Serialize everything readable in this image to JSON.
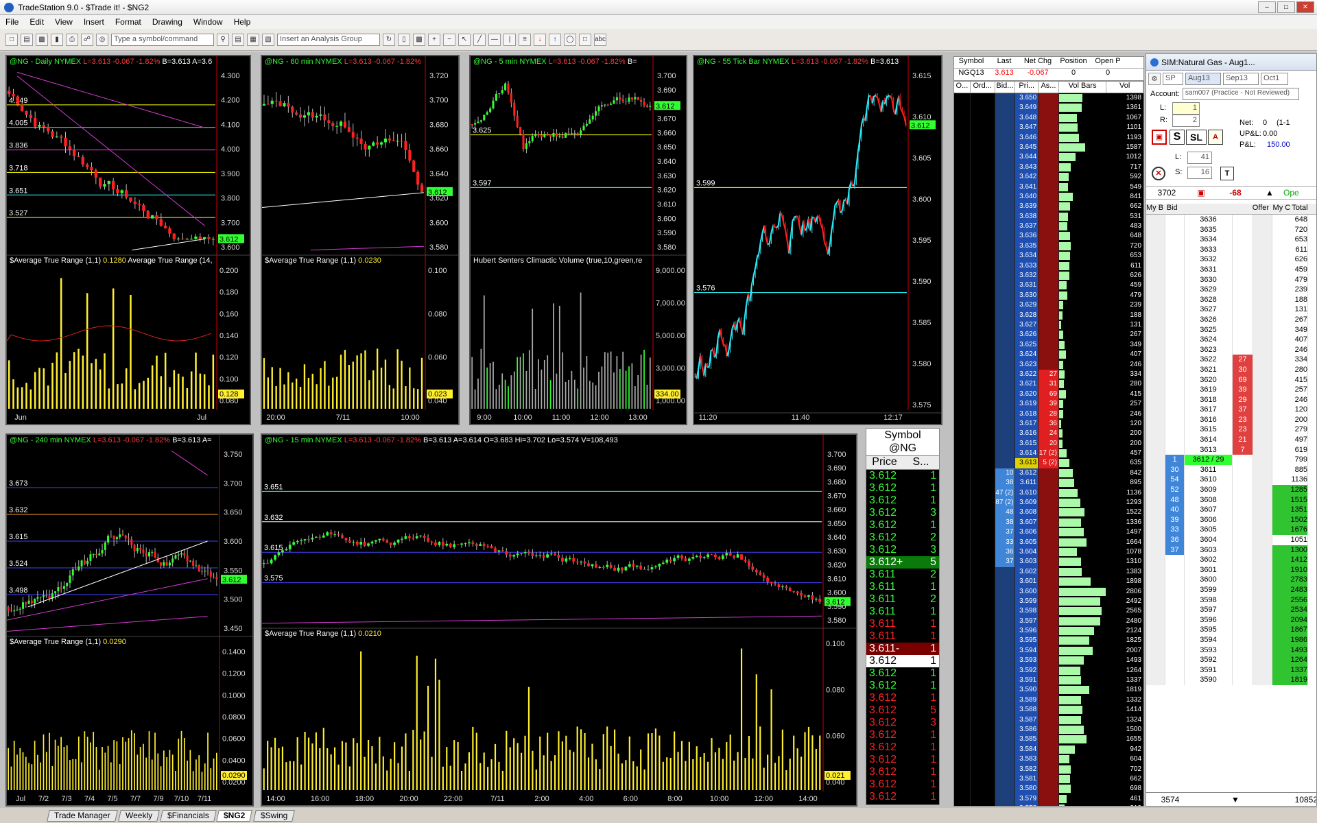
{
  "app": {
    "title": "TradeStation 9.0 - $Trade it! - $NG2",
    "menu": [
      "File",
      "Edit",
      "View",
      "Insert",
      "Format",
      "Drawing",
      "Window",
      "Help"
    ],
    "symbol_placeholder": "Type a symbol/command",
    "analysis_group": "Insert an Analysis Group"
  },
  "charts": [
    {
      "id": "daily",
      "title": "@NG - Daily  NYMEX",
      "quote": "L=3.613  -0.067  -1.82%",
      "extra": "B=3.613  A=3.6",
      "sub": "$Average True Range (1,1)",
      "subval": "0.1280",
      "sub2": "Average True Range (14,",
      "yticks": [
        "4.300",
        "4.200",
        "4.100",
        "4.000",
        "3.900",
        "3.800",
        "3.700",
        "3.600"
      ],
      "subticks": [
        "0.200",
        "0.180",
        "0.160",
        "0.140",
        "0.120",
        "0.100",
        "0.080"
      ],
      "xticks": [
        "Jun",
        "Jul"
      ],
      "levels": [
        "4.149",
        "4.005",
        "3.836",
        "3.718",
        "3.651",
        "3.527"
      ],
      "last": "3.612",
      "sublast": "0.128"
    },
    {
      "id": "m60",
      "title": "@NG - 60 min  NYMEX",
      "quote": "L=3.613  -0.067  -1.82%",
      "extra": "",
      "sub": "$Average True Range (1,1)",
      "subval": "0.0230",
      "yticks": [
        "3.720",
        "3.700",
        "3.680",
        "3.660",
        "3.640",
        "3.620",
        "3.600",
        "3.580"
      ],
      "subticks": [
        "0.100",
        "0.080",
        "0.060",
        "0.040"
      ],
      "xticks": [
        "20:00",
        "7/11",
        "10:00"
      ],
      "last": "3.612",
      "sublast": "0.023"
    },
    {
      "id": "m5",
      "title": "@NG - 5 min  NYMEX",
      "quote": "L=3.613  -0.067  -1.82%",
      "extra": "B=",
      "sub": "Hubert Senters Climactic Volume (true,10,green,re",
      "yticks": [
        "3.700",
        "3.690",
        "3.680",
        "3.670",
        "3.660",
        "3.650",
        "3.640",
        "3.630",
        "3.620",
        "3.610",
        "3.600",
        "3.590",
        "3.580"
      ],
      "subticks": [
        "9,000.00",
        "7,000.00",
        "5,000.00",
        "3,000.00",
        "1,000.00"
      ],
      "xticks": [
        "9:00",
        "10:00",
        "11:00",
        "12:00",
        "13:00"
      ],
      "levels": [
        "3.625",
        "3.597"
      ],
      "last": "3.612",
      "sublast": "334.00"
    },
    {
      "id": "tick",
      "title": "@NG - 55 Tick Bar  NYMEX",
      "quote": "L=3.613  -0.067  -1.82%",
      "extra": "B=3.613",
      "yticks": [
        "3.615",
        "3.610",
        "3.605",
        "3.600",
        "3.595",
        "3.590",
        "3.585",
        "3.580",
        "3.575"
      ],
      "xticks": [
        "11:20",
        "11:40",
        "12:17"
      ],
      "levels": [
        "3.599",
        "3.576"
      ],
      "last": "3.612"
    },
    {
      "id": "m240",
      "title": "@NG - 240 min  NYMEX",
      "quote": "L=3.613  -0.067  -1.82%",
      "extra": "B=3.613  A=",
      "sub": "$Average True Range (1,1)",
      "subval": "0.0290",
      "yticks": [
        "3.750",
        "3.700",
        "3.650",
        "3.600",
        "3.550",
        "3.500",
        "3.450"
      ],
      "subticks": [
        "0.1400",
        "0.1200",
        "0.1000",
        "0.0800",
        "0.0600",
        "0.0400",
        "0.0200"
      ],
      "xticks": [
        "Jul",
        "7/2",
        "7/3",
        "7/4",
        "7/5",
        "7/7",
        "7/9",
        "7/10",
        "7/11"
      ],
      "levels": [
        "3.673",
        "3.632",
        "3.615",
        "3.524",
        "3.498"
      ],
      "last": "3.612",
      "sublast": "0.0290"
    },
    {
      "id": "m15",
      "title": "@NG - 15 min  NYMEX",
      "quote": "L=3.613  -0.067  -1.82%",
      "extra": "B=3.613  A=3.614",
      "ohlc": "O=3.683  Hi=3.702  Lo=3.574  V=108,493",
      "sub": "$Average True Range (1,1)",
      "subval": "0.0210",
      "yticks": [
        "3.700",
        "3.690",
        "3.680",
        "3.670",
        "3.660",
        "3.650",
        "3.640",
        "3.630",
        "3.620",
        "3.610",
        "3.600",
        "3.590",
        "3.580"
      ],
      "subticks": [
        "0.100",
        "0.080",
        "0.060",
        "0.040"
      ],
      "xticks": [
        "14:00",
        "16:00",
        "18:00",
        "20:00",
        "22:00",
        "7/11",
        "2:00",
        "4:00",
        "6:00",
        "8:00",
        "10:00",
        "12:00",
        "14:00"
      ],
      "levels": [
        "3.651",
        "3.632",
        "3.615",
        "3.575"
      ],
      "last": "3.612",
      "sublast": "0.021"
    }
  ],
  "tns": {
    "title": "Symbol",
    "symbol": "@NG",
    "col_price": "Price",
    "col_size": "S...",
    "rows": [
      [
        "3.612",
        "1",
        "g"
      ],
      [
        "3.612",
        "1",
        "g"
      ],
      [
        "3.612",
        "1",
        "g"
      ],
      [
        "3.612",
        "3",
        "g"
      ],
      [
        "3.612",
        "1",
        "g"
      ],
      [
        "3.612",
        "2",
        "g"
      ],
      [
        "3.612",
        "3",
        "g"
      ],
      [
        "3.612+",
        "5",
        "gb"
      ],
      [
        "3.611",
        "2",
        "g"
      ],
      [
        "3.611",
        "1",
        "g"
      ],
      [
        "3.611",
        "2",
        "g"
      ],
      [
        "3.611",
        "1",
        "g"
      ],
      [
        "3.611",
        "1",
        "r"
      ],
      [
        "3.611",
        "1",
        "r"
      ],
      [
        "3.611-",
        "1",
        "rb"
      ],
      [
        "3.612",
        "1",
        "w"
      ],
      [
        "3.612",
        "1",
        "g"
      ],
      [
        "3.612",
        "1",
        "g"
      ],
      [
        "3.612",
        "1",
        "r"
      ],
      [
        "3.612",
        "5",
        "r"
      ],
      [
        "3.612",
        "3",
        "r"
      ],
      [
        "3.612",
        "1",
        "r"
      ],
      [
        "3.612",
        "1",
        "r"
      ],
      [
        "3.612",
        "1",
        "r"
      ],
      [
        "3.612",
        "1",
        "r"
      ],
      [
        "3.612",
        "1",
        "r"
      ],
      [
        "3.612",
        "1",
        "r"
      ]
    ]
  },
  "quote": {
    "symbol_h": "Symbol",
    "last_h": "Last",
    "net_h": "Net Chg",
    "pos_h": "Position",
    "open_h": "Open P",
    "symbol": "NGQ13",
    "last": "3.613",
    "net": "-0.067",
    "pos": "0",
    "open": "0"
  },
  "ladder": {
    "cols": [
      "O...",
      "Ord...",
      "Bid...",
      "Pri...",
      "As...",
      "Vol Bars",
      "Vol"
    ],
    "rows": [
      [
        "",
        "3.650",
        "",
        "1398"
      ],
      [
        "",
        "3.649",
        "",
        "1361"
      ],
      [
        "",
        "3.648",
        "",
        "1067"
      ],
      [
        "",
        "3.647",
        "",
        "1101"
      ],
      [
        "",
        "3.646",
        "",
        "1193"
      ],
      [
        "",
        "3.645",
        "",
        "1587"
      ],
      [
        "",
        "3.644",
        "",
        "1012"
      ],
      [
        "",
        "3.643",
        "",
        "717"
      ],
      [
        "",
        "3.642",
        "",
        "592"
      ],
      [
        "",
        "3.641",
        "",
        "549"
      ],
      [
        "",
        "3.640",
        "",
        "841"
      ],
      [
        "",
        "3.639",
        "",
        "662"
      ],
      [
        "",
        "3.638",
        "",
        "531"
      ],
      [
        "",
        "3.637",
        "",
        "483"
      ],
      [
        "",
        "3.636",
        "",
        "648"
      ],
      [
        "",
        "3.635",
        "",
        "720"
      ],
      [
        "",
        "3.634",
        "",
        "653"
      ],
      [
        "",
        "3.633",
        "",
        "611"
      ],
      [
        "",
        "3.632",
        "",
        "626"
      ],
      [
        "",
        "3.631",
        "",
        "459"
      ],
      [
        "",
        "3.630",
        "",
        "479"
      ],
      [
        "",
        "3.629",
        "",
        "239"
      ],
      [
        "",
        "3.628",
        "",
        "188"
      ],
      [
        "",
        "3.627",
        "",
        "131"
      ],
      [
        "",
        "3.626",
        "",
        "267"
      ],
      [
        "",
        "3.625",
        "",
        "349"
      ],
      [
        "",
        "3.624",
        "",
        "407"
      ],
      [
        "",
        "3.623",
        "",
        "246"
      ],
      [
        "",
        "3.622",
        "27",
        "334"
      ],
      [
        "",
        "3.621",
        "31",
        "280"
      ],
      [
        "",
        "3.620",
        "69",
        "415"
      ],
      [
        "",
        "3.619",
        "39",
        "257"
      ],
      [
        "",
        "3.618",
        "28",
        "246"
      ],
      [
        "",
        "3.617",
        "36",
        "120"
      ],
      [
        "",
        "3.616",
        "24",
        "200"
      ],
      [
        "",
        "3.615",
        "20",
        "200"
      ],
      [
        "",
        "3.614",
        "17 (2)",
        "457"
      ],
      [
        "",
        "3.613",
        "5 (2)",
        "635"
      ],
      [
        "10",
        "3.612",
        "",
        "842"
      ],
      [
        "38",
        "3.611",
        "",
        "895"
      ],
      [
        "47 (2)",
        "3.610",
        "",
        "1136"
      ],
      [
        "87 (2)",
        "3.609",
        "",
        "1293"
      ],
      [
        "48",
        "3.608",
        "",
        "1522"
      ],
      [
        "38",
        "3.607",
        "",
        "1336"
      ],
      [
        "37",
        "3.606",
        "",
        "1497"
      ],
      [
        "33",
        "3.605",
        "",
        "1664"
      ],
      [
        "36",
        "3.604",
        "",
        "1078"
      ],
      [
        "37",
        "3.603",
        "",
        "1310"
      ],
      [
        "",
        "3.602",
        "",
        "1383"
      ],
      [
        "",
        "3.601",
        "",
        "1898"
      ],
      [
        "",
        "3.600",
        "",
        "2806"
      ],
      [
        "",
        "3.599",
        "",
        "2492"
      ],
      [
        "",
        "3.598",
        "",
        "2565"
      ],
      [
        "",
        "3.597",
        "",
        "2480"
      ],
      [
        "",
        "3.596",
        "",
        "2124"
      ],
      [
        "",
        "3.595",
        "",
        "1825"
      ],
      [
        "",
        "3.594",
        "",
        "2007"
      ],
      [
        "",
        "3.593",
        "",
        "1493"
      ],
      [
        "",
        "3.592",
        "",
        "1264"
      ],
      [
        "",
        "3.591",
        "",
        "1337"
      ],
      [
        "",
        "3.590",
        "",
        "1819"
      ],
      [
        "",
        "3.589",
        "",
        "1332"
      ],
      [
        "",
        "3.588",
        "",
        "1414"
      ],
      [
        "",
        "3.587",
        "",
        "1324"
      ],
      [
        "",
        "3.586",
        "",
        "1500"
      ],
      [
        "",
        "3.585",
        "",
        "1655"
      ],
      [
        "",
        "3.584",
        "",
        "942"
      ],
      [
        "",
        "3.583",
        "",
        "604"
      ],
      [
        "",
        "3.582",
        "",
        "702"
      ],
      [
        "",
        "3.581",
        "",
        "662"
      ],
      [
        "",
        "3.580",
        "",
        "698"
      ],
      [
        "",
        "3.579",
        "",
        "461"
      ],
      [
        "",
        "3.578",
        "",
        "319"
      ],
      [
        "",
        "3.577",
        "",
        "291"
      ]
    ]
  },
  "dom": {
    "title": "SIM:Natural Gas - Aug1...",
    "sp": "SP",
    "month1": "Aug13",
    "month2": "Sep13",
    "month3": "Oct1",
    "account_label": "Account:",
    "account": "sam007 (Practice - Not Reviewed)",
    "L_label": "L:",
    "L_val": "1",
    "R_label": "R:",
    "R_val": "2",
    "net_label": "Net:",
    "net": "0",
    "net2": "(1-1",
    "upl_label": "UP&L:",
    "upl": "0.00",
    "pl_label": "P&L:",
    "pl": "150.00",
    "L2_label": "L:",
    "L2": "41",
    "S_label": "S:",
    "S": "16",
    "price_top": "3702",
    "delta": "-68",
    "status": "Ope",
    "cols": [
      "My B",
      "Bid",
      "",
      "Offer",
      "My C",
      "Total"
    ],
    "rows": [
      [
        "",
        "3636",
        "",
        "648"
      ],
      [
        "",
        "3635",
        "",
        "720"
      ],
      [
        "",
        "3634",
        "",
        "653"
      ],
      [
        "",
        "3633",
        "",
        "611"
      ],
      [
        "",
        "3632",
        "",
        "626"
      ],
      [
        "",
        "3631",
        "",
        "459"
      ],
      [
        "",
        "3630",
        "",
        "479"
      ],
      [
        "",
        "3629",
        "",
        "239"
      ],
      [
        "",
        "3628",
        "",
        "188"
      ],
      [
        "",
        "3627",
        "",
        "131"
      ],
      [
        "",
        "3626",
        "",
        "267"
      ],
      [
        "",
        "3625",
        "",
        "349"
      ],
      [
        "",
        "3624",
        "",
        "407"
      ],
      [
        "",
        "3623",
        "",
        "246"
      ],
      [
        "",
        "3622",
        "27",
        "334"
      ],
      [
        "",
        "3621",
        "30",
        "280"
      ],
      [
        "",
        "3620",
        "69",
        "415"
      ],
      [
        "",
        "3619",
        "39",
        "257"
      ],
      [
        "",
        "3618",
        "29",
        "246"
      ],
      [
        "",
        "3617",
        "37",
        "120"
      ],
      [
        "",
        "3616",
        "23",
        "200"
      ],
      [
        "",
        "3615",
        "23",
        "279"
      ],
      [
        "",
        "3614",
        "21",
        "497"
      ],
      [
        "",
        "3613",
        "7",
        "619"
      ],
      [
        "1",
        "3612 / 29",
        "",
        "799"
      ],
      [
        "30",
        "3611",
        "",
        "885"
      ],
      [
        "54",
        "3610",
        "",
        "1136"
      ],
      [
        "52",
        "3609",
        "",
        "1285"
      ],
      [
        "48",
        "3608",
        "",
        "1515"
      ],
      [
        "40",
        "3607",
        "",
        "1351"
      ],
      [
        "39",
        "3606",
        "",
        "1502"
      ],
      [
        "33",
        "3605",
        "",
        "1676"
      ],
      [
        "36",
        "3604",
        "",
        "1051"
      ],
      [
        "37",
        "3603",
        "",
        "1300"
      ],
      [
        "",
        "3602",
        "",
        "1412"
      ],
      [
        "",
        "3601",
        "",
        "1910"
      ],
      [
        "",
        "3600",
        "",
        "2783"
      ],
      [
        "",
        "3599",
        "",
        "2483"
      ],
      [
        "",
        "3598",
        "",
        "2556"
      ],
      [
        "",
        "3597",
        "",
        "2534"
      ],
      [
        "",
        "3596",
        "",
        "2094"
      ],
      [
        "",
        "3595",
        "",
        "1867"
      ],
      [
        "",
        "3594",
        "",
        "1986"
      ],
      [
        "",
        "3593",
        "",
        "1493"
      ],
      [
        "",
        "3592",
        "",
        "1264"
      ],
      [
        "",
        "3591",
        "",
        "1337"
      ],
      [
        "",
        "3590",
        "",
        "1819"
      ]
    ],
    "bottom_price": "3574",
    "bottom_total": "10852"
  },
  "tabs": [
    "Trade Manager",
    "Weekly",
    "$Financials",
    "$NG2",
    "$Swing"
  ],
  "active_tab": "$NG2",
  "colors": {
    "up": "#31ff31",
    "down": "#ff2020",
    "cyan": "#2ee8f5",
    "yellow": "#ffef2e",
    "ladderBid": "#3f86d9",
    "ladderAsk": "#d22b1b",
    "volbar": "#a9f9a9"
  }
}
